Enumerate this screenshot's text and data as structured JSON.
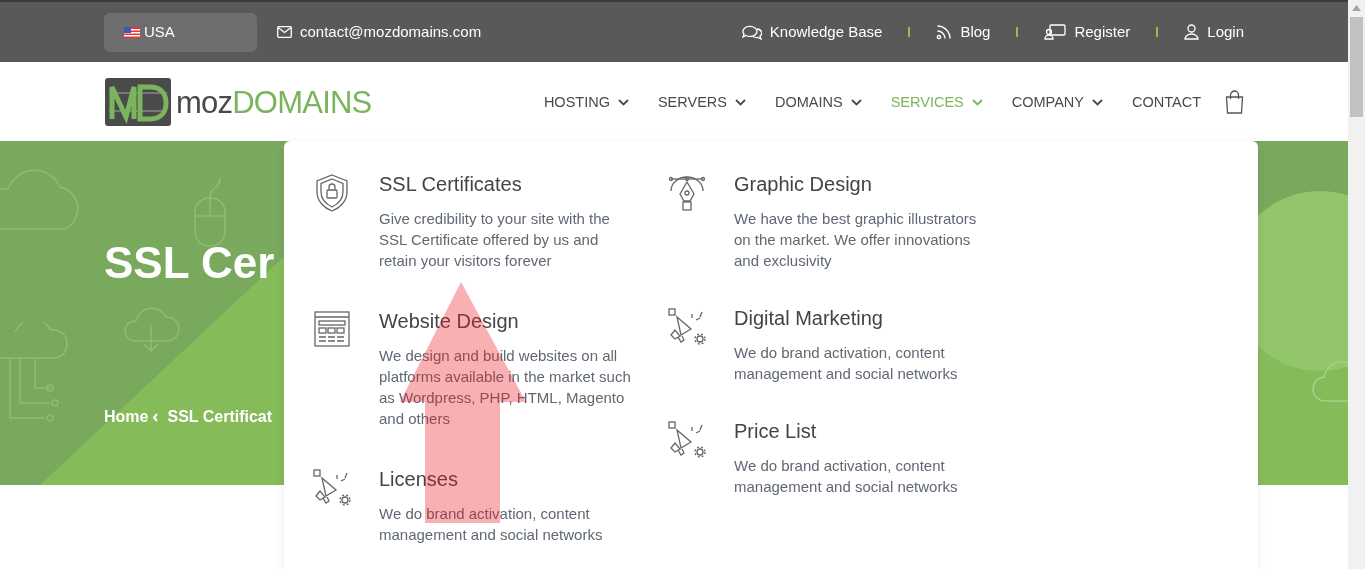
{
  "top_bar": {
    "country": "USA",
    "email": "contact@mozdomains.com",
    "links": [
      {
        "label": "Knowledge Base"
      },
      {
        "label": "Blog"
      },
      {
        "label": "Register"
      },
      {
        "label": "Login"
      }
    ]
  },
  "logo": {
    "first": "moz",
    "second": "DOMAINS"
  },
  "nav": [
    {
      "label": "HOSTING",
      "dropdown": true,
      "selected": false
    },
    {
      "label": "SERVERS",
      "dropdown": true,
      "selected": false
    },
    {
      "label": "DOMAINS",
      "dropdown": true,
      "selected": false
    },
    {
      "label": "SERVICES",
      "dropdown": true,
      "selected": true
    },
    {
      "label": "COMPANY",
      "dropdown": true,
      "selected": false
    },
    {
      "label": "CONTACT",
      "dropdown": false,
      "selected": false
    }
  ],
  "hero": {
    "title": "SSL Cer",
    "breadcrumb": [
      "Home",
      "SSL Certificat"
    ]
  },
  "services_menu": {
    "columns": [
      [
        {
          "title": "SSL Certificates",
          "description": "Give credibility to your site with the SSL Certificate offered by us and retain your visitors forever"
        },
        {
          "title": "Website Design",
          "description": "We design and build websites on all platforms available in the market such as Wordpress, PHP, HTML, Magento and others"
        },
        {
          "title": "Licenses",
          "description": "We do brand activation, content management and social networks"
        }
      ],
      [
        {
          "title": "Graphic Design",
          "description": "We have the best graphic illustrators on the market. We offer innovations and exclusivity"
        },
        {
          "title": "Digital Marketing",
          "description": "We do brand activation, content management and social networks"
        },
        {
          "title": "Price List",
          "description": "We do brand activation, content management and social networks"
        }
      ]
    ]
  }
}
